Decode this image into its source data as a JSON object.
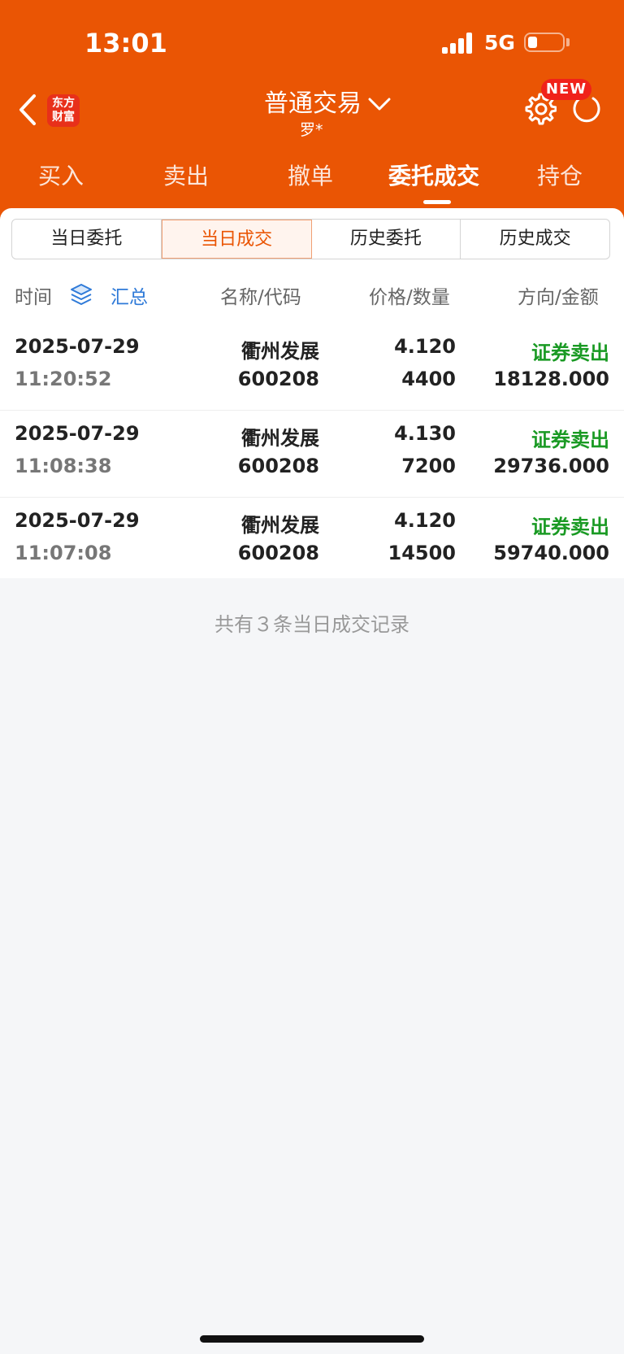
{
  "status_bar": {
    "time": "13:01",
    "network": "5G"
  },
  "header": {
    "logo_line1": "东方",
    "logo_line2": "财富",
    "title": "普通交易",
    "subtitle": "罗*",
    "new_badge": "NEW"
  },
  "tabs": [
    "买入",
    "卖出",
    "撤单",
    "委托成交",
    "持仓"
  ],
  "active_tab_index": 3,
  "segments": [
    "当日委托",
    "当日成交",
    "历史委托",
    "历史成交"
  ],
  "active_segment_index": 1,
  "columns": {
    "time": "时间",
    "summary": "汇总",
    "name_code": "名称/代码",
    "price_qty": "价格/数量",
    "direction_amount": "方向/金额"
  },
  "rows": [
    {
      "date": "2025-07-29",
      "time": "11:20:52",
      "name": "衢州发展",
      "code": "600208",
      "price": "4.120",
      "quantity": "4400",
      "direction": "证券卖出",
      "amount": "18128.000"
    },
    {
      "date": "2025-07-29",
      "time": "11:08:38",
      "name": "衢州发展",
      "code": "600208",
      "price": "4.130",
      "quantity": "7200",
      "direction": "证券卖出",
      "amount": "29736.000"
    },
    {
      "date": "2025-07-29",
      "time": "11:07:08",
      "name": "衢州发展",
      "code": "600208",
      "price": "4.120",
      "quantity": "14500",
      "direction": "证券卖出",
      "amount": "59740.000"
    }
  ],
  "footer_note": "共有３条当日成交记录",
  "colors": {
    "brand": "#ea5504",
    "sell": "#1a9a24",
    "link": "#2f7ad8",
    "badge": "#f0221a"
  },
  "icons": [
    "back-icon",
    "gear-icon",
    "refresh-icon",
    "layers-icon",
    "chevron-down-icon"
  ]
}
